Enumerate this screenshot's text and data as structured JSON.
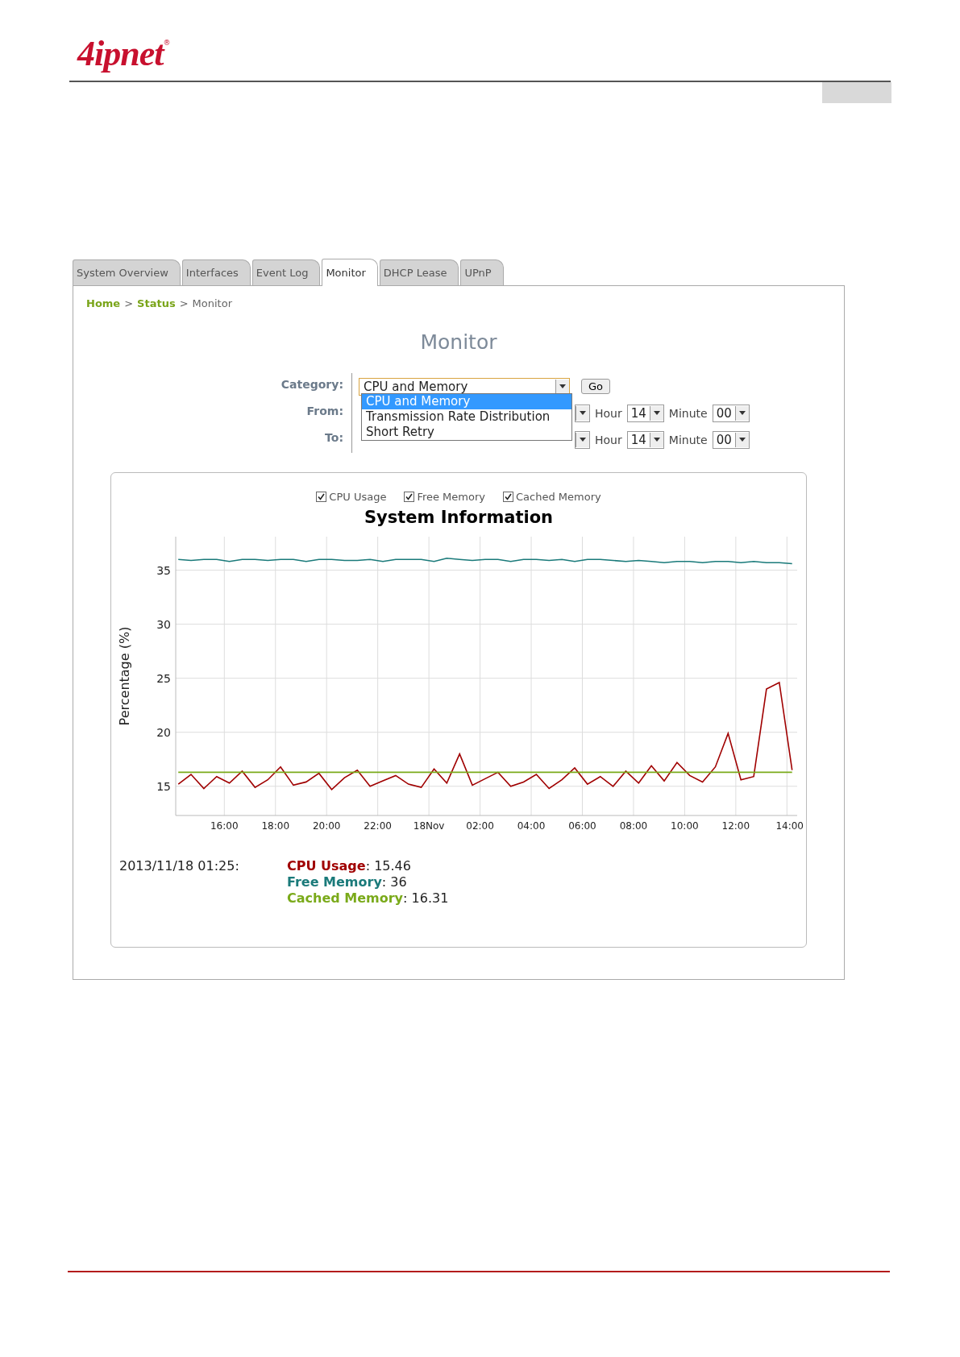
{
  "header": {
    "logo": "4ipnet",
    "registered_mark": "®"
  },
  "tabs": [
    {
      "label": "System Overview",
      "selected": false
    },
    {
      "label": "Interfaces",
      "selected": false
    },
    {
      "label": "Event Log",
      "selected": false
    },
    {
      "label": "Monitor",
      "selected": true
    },
    {
      "label": "DHCP Lease",
      "selected": false
    },
    {
      "label": "UPnP",
      "selected": false
    }
  ],
  "breadcrumb": {
    "separator": ">",
    "items": [
      {
        "label": "Home",
        "link": true
      },
      {
        "label": "Status",
        "link": true
      },
      {
        "label": "Monitor",
        "link": false
      }
    ]
  },
  "title": "Monitor",
  "form": {
    "category": {
      "label": "Category:",
      "value": "CPU and Memory",
      "go_button": "Go",
      "options": [
        {
          "label": "CPU and Memory",
          "selected": true
        },
        {
          "label": "Transmission Rate Distribution",
          "selected": false
        },
        {
          "label": "Short Retry",
          "selected": false
        }
      ]
    },
    "rows": [
      {
        "label": "From:",
        "hour_label": "Hour",
        "hour": "14",
        "minute_label": "Minute",
        "minute": "00"
      },
      {
        "label": "To:",
        "hour_label": "Hour",
        "hour": "14",
        "minute_label": "Minute",
        "minute": "00"
      }
    ]
  },
  "chart": {
    "legend": [
      {
        "checked": true
      },
      {
        "checked": true
      },
      {
        "checked": true
      }
    ],
    "chart_data": {
      "type": "line",
      "title": "System Information",
      "ylabel": "Percentage (%)",
      "grid": true,
      "x": [
        "2013-11-17T14:12",
        "2013-11-17T14:42",
        "2013-11-17T15:12",
        "2013-11-17T15:42",
        "2013-11-17T16:12",
        "2013-11-17T16:42",
        "2013-11-17T17:12",
        "2013-11-17T17:42",
        "2013-11-17T18:12",
        "2013-11-17T18:42",
        "2013-11-17T19:12",
        "2013-11-17T19:42",
        "2013-11-17T20:12",
        "2013-11-17T20:42",
        "2013-11-17T21:12",
        "2013-11-17T21:42",
        "2013-11-17T22:12",
        "2013-11-17T22:42",
        "2013-11-17T23:12",
        "2013-11-17T23:42",
        "2013-11-18T00:12",
        "2013-11-18T00:42",
        "2013-11-18T01:12",
        "2013-11-18T01:42",
        "2013-11-18T02:12",
        "2013-11-18T02:42",
        "2013-11-18T03:12",
        "2013-11-18T03:42",
        "2013-11-18T04:12",
        "2013-11-18T04:42",
        "2013-11-18T05:12",
        "2013-11-18T05:42",
        "2013-11-18T06:12",
        "2013-11-18T06:42",
        "2013-11-18T07:12",
        "2013-11-18T07:42",
        "2013-11-18T08:12",
        "2013-11-18T08:42",
        "2013-11-18T09:12",
        "2013-11-18T09:42",
        "2013-11-18T10:12",
        "2013-11-18T10:42",
        "2013-11-18T11:12",
        "2013-11-18T11:42",
        "2013-11-18T12:12",
        "2013-11-18T12:42",
        "2013-11-18T13:12",
        "2013-11-18T13:42",
        "2013-11-18T14:12"
      ],
      "series": [
        {
          "name": "CPU Usage",
          "color": "#a00000",
          "values": [
            15.2,
            16.1,
            14.8,
            15.9,
            15.3,
            16.4,
            14.9,
            15.6,
            16.8,
            15.1,
            15.4,
            16.2,
            14.7,
            15.8,
            16.5,
            15.0,
            15.5,
            16.0,
            15.2,
            14.9,
            16.6,
            15.3,
            18.0,
            15.1,
            15.7,
            16.3,
            15.0,
            15.4,
            16.1,
            14.8,
            15.6,
            16.7,
            15.2,
            15.9,
            15.0,
            16.4,
            15.3,
            16.9,
            15.5,
            17.2,
            16.0,
            15.4,
            16.8,
            19.9,
            15.6,
            15.9,
            24.0,
            24.6,
            16.5
          ]
        },
        {
          "name": "Free Memory",
          "color": "#1a7a7a",
          "values": [
            36.0,
            35.9,
            36.0,
            36.0,
            35.8,
            36.0,
            36.0,
            35.9,
            36.0,
            36.0,
            35.8,
            36.0,
            36.0,
            35.9,
            35.9,
            36.0,
            35.8,
            36.0,
            36.0,
            36.0,
            35.8,
            36.1,
            36.0,
            35.9,
            36.0,
            36.0,
            35.8,
            36.0,
            36.0,
            35.9,
            36.0,
            35.8,
            36.0,
            36.0,
            35.9,
            35.8,
            35.9,
            35.8,
            35.7,
            35.8,
            35.8,
            35.7,
            35.8,
            35.8,
            35.7,
            35.8,
            35.7,
            35.7,
            35.6
          ]
        },
        {
          "name": "Cached Memory",
          "color": "#7aaa1a",
          "values": [
            16.3,
            16.3,
            16.3,
            16.3,
            16.3,
            16.3,
            16.3,
            16.3,
            16.3,
            16.3,
            16.3,
            16.3,
            16.3,
            16.3,
            16.3,
            16.3,
            16.3,
            16.3,
            16.3,
            16.3,
            16.3,
            16.3,
            16.3,
            16.3,
            16.3,
            16.3,
            16.3,
            16.3,
            16.3,
            16.3,
            16.3,
            16.3,
            16.3,
            16.3,
            16.3,
            16.3,
            16.3,
            16.3,
            16.3,
            16.3,
            16.3,
            16.3,
            16.3,
            16.3,
            16.3,
            16.3,
            16.3,
            16.3,
            16.3
          ]
        }
      ],
      "xlim": [
        "2013-11-17T14:06",
        "2013-11-18T14:24"
      ],
      "ylim": [
        12.3,
        38.1
      ],
      "xticks": [
        {
          "value": "2013-11-17T16:00",
          "label": "16:00"
        },
        {
          "value": "2013-11-17T18:00",
          "label": "18:00"
        },
        {
          "value": "2013-11-17T20:00",
          "label": "20:00"
        },
        {
          "value": "2013-11-17T22:00",
          "label": "22:00"
        },
        {
          "value": "2013-11-18T00:00",
          "label": "18Nov"
        },
        {
          "value": "2013-11-18T02:00",
          "label": "02:00"
        },
        {
          "value": "2013-11-18T04:00",
          "label": "04:00"
        },
        {
          "value": "2013-11-18T06:00",
          "label": "06:00"
        },
        {
          "value": "2013-11-18T08:00",
          "label": "08:00"
        },
        {
          "value": "2013-11-18T10:00",
          "label": "10:00"
        },
        {
          "value": "2013-11-18T12:00",
          "label": "12:00"
        },
        {
          "value": "2013-11-18T14:00",
          "label": "14:00"
        }
      ],
      "yticks": [
        15,
        20,
        25,
        30,
        35
      ]
    }
  },
  "readout": {
    "time": "2013/11/18 01:25:",
    "separator": ":",
    "items": [
      {
        "label": "CPU Usage",
        "value": "15.46",
        "color": "#a00000"
      },
      {
        "label": "Free Memory",
        "value": "36",
        "color": "#1a7a7a"
      },
      {
        "label": "Cached Memory",
        "value": "16.31",
        "color": "#7aaa1a"
      }
    ]
  }
}
